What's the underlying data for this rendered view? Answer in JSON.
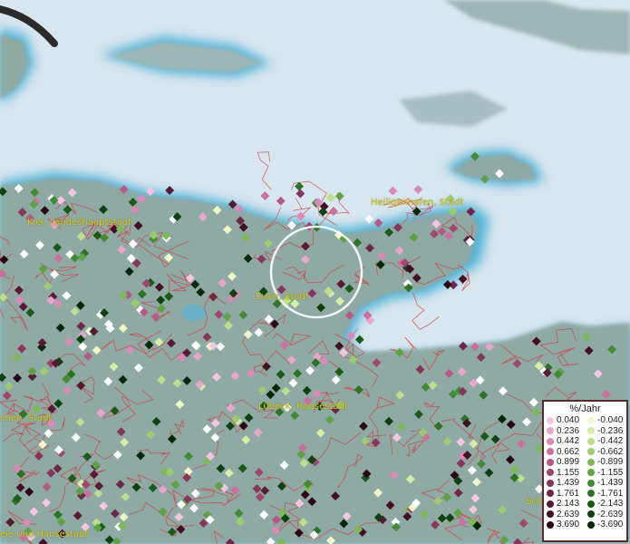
{
  "cities": [
    {
      "name": "Heiligenhafen, Stadt"
    },
    {
      "name": "Kiel, Landeshauptstadt"
    },
    {
      "name": "Eutin, Stadt"
    },
    {
      "name": "Lübeck, Hansestadt"
    },
    {
      "name": "chen, Stadt"
    },
    {
      "name": "eie und Hansestadt"
    },
    {
      "name": "Sch"
    }
  ],
  "legend": {
    "title": "%/Jahr",
    "positive": [
      {
        "label": "0.040",
        "color": "#f4c6e4"
      },
      {
        "label": "0.236",
        "color": "#e8a6cf"
      },
      {
        "label": "0.442",
        "color": "#d98ab8"
      },
      {
        "label": "0.662",
        "color": "#c9709f"
      },
      {
        "label": "0.899",
        "color": "#b45a87"
      },
      {
        "label": "1.155",
        "color": "#9d4670"
      },
      {
        "label": "1.439",
        "color": "#86365c"
      },
      {
        "label": "1.761",
        "color": "#6e2748"
      },
      {
        "label": "2.143",
        "color": "#571a36"
      },
      {
        "label": "2.639",
        "color": "#410f26"
      },
      {
        "label": "3.690",
        "color": "#2a0716"
      }
    ],
    "negative": [
      {
        "label": "-0.040",
        "color": "#f2f7c9"
      },
      {
        "label": "-0.236",
        "color": "#d8ecaa"
      },
      {
        "label": "-0.442",
        "color": "#bcde8d"
      },
      {
        "label": "-0.662",
        "color": "#9ccc72"
      },
      {
        "label": "-0.899",
        "color": "#7db85b"
      },
      {
        "label": "-1.155",
        "color": "#5fa147"
      },
      {
        "label": "-1.439",
        "color": "#438a35"
      },
      {
        "label": "-1.761",
        "color": "#2d7326"
      },
      {
        "label": "-2.143",
        "color": "#1b5b19"
      },
      {
        "label": "-2.639",
        "color": "#0d420f"
      },
      {
        "label": "-3.690",
        "color": "#032806"
      }
    ]
  },
  "colors": {
    "sea": "#d8e6ef",
    "land": "#8fa9a4",
    "coast": "#5bb4d6",
    "boundary": "#d63b3b",
    "label": "#e2d21a"
  }
}
